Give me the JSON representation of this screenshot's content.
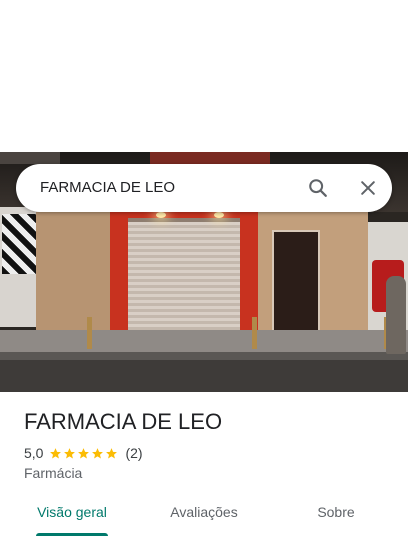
{
  "search": {
    "query": "FARMACIA DE LEO",
    "search_icon": "search-icon",
    "close_icon": "close-icon"
  },
  "place": {
    "name": "FARMACIA DE LEO",
    "rating": "5,0",
    "stars_filled": 5,
    "stars_total": 5,
    "reviews": "(2)",
    "category": "Farmácia"
  },
  "tabs": [
    {
      "label": "Visão geral",
      "active": true
    },
    {
      "label": "Avaliações",
      "active": false
    },
    {
      "label": "Sobre",
      "active": false
    }
  ],
  "colors": {
    "accent": "#00796b",
    "star": "#fbbc04",
    "title_text": "#202124",
    "secondary_text": "#5f6368"
  }
}
